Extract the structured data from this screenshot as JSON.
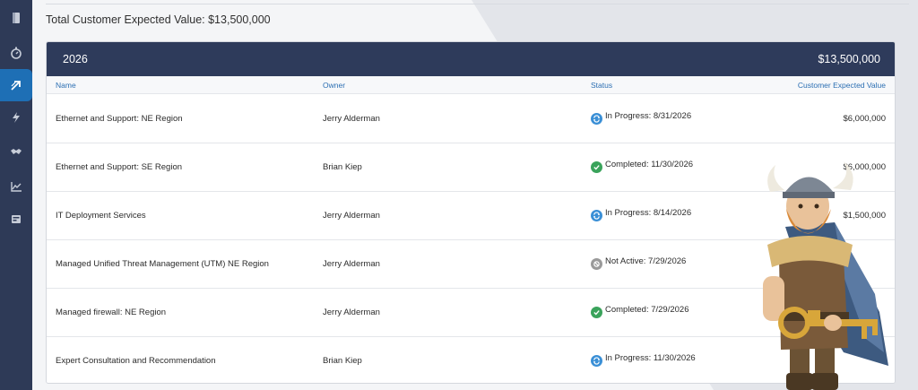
{
  "sidebar": {
    "items": [
      {
        "icon": "document-icon"
      },
      {
        "icon": "stopwatch-icon"
      },
      {
        "icon": "arrow-up-right-icon",
        "active": true
      },
      {
        "icon": "lightning-icon"
      },
      {
        "icon": "handshake-icon"
      },
      {
        "icon": "chart-icon"
      },
      {
        "icon": "card-icon"
      }
    ]
  },
  "summary": {
    "total_text": "Total Customer Expected Value: $13,500,000"
  },
  "group": {
    "year": "2026",
    "value": "$13,500,000"
  },
  "table": {
    "headers": {
      "name": "Name",
      "owner": "Owner",
      "status": "Status",
      "value": "Customer Expected Value"
    },
    "rows": [
      {
        "name": "Ethernet and Support: NE Region",
        "owner": "Jerry Alderman",
        "status": "In Progress: 8/31/2026",
        "status_type": "in-progress",
        "value": "$6,000,000"
      },
      {
        "name": "Ethernet and Support: SE Region",
        "owner": "Brian Kiep",
        "status": "Completed: 11/30/2026",
        "status_type": "completed",
        "value": "$6,000,000"
      },
      {
        "name": "IT Deployment Services",
        "owner": "Jerry Alderman",
        "status": "In Progress: 8/14/2026",
        "status_type": "in-progress",
        "value": "$1,500,000"
      },
      {
        "name": "Managed Unified Threat Management (UTM) NE Region",
        "owner": "Jerry Alderman",
        "status": "Not Active: 7/29/2026",
        "status_type": "not-active",
        "value": ""
      },
      {
        "name": "Managed firewall: NE Region",
        "owner": "Jerry Alderman",
        "status": "Completed: 7/29/2026",
        "status_type": "completed",
        "value": ""
      },
      {
        "name": "Expert Consultation and Recommendation",
        "owner": "Brian Kiep",
        "status": "In Progress: 11/30/2026",
        "status_type": "in-progress",
        "value": ""
      }
    ]
  },
  "colors": {
    "sidebar_bg": "#2e3a57",
    "sidebar_active": "#1e6fb5",
    "header_bar": "#2e3b5b",
    "link_blue": "#2c6fb3",
    "in_progress": "#3a8fd6",
    "completed": "#3aa35b",
    "not_active": "#9a9a9a"
  }
}
